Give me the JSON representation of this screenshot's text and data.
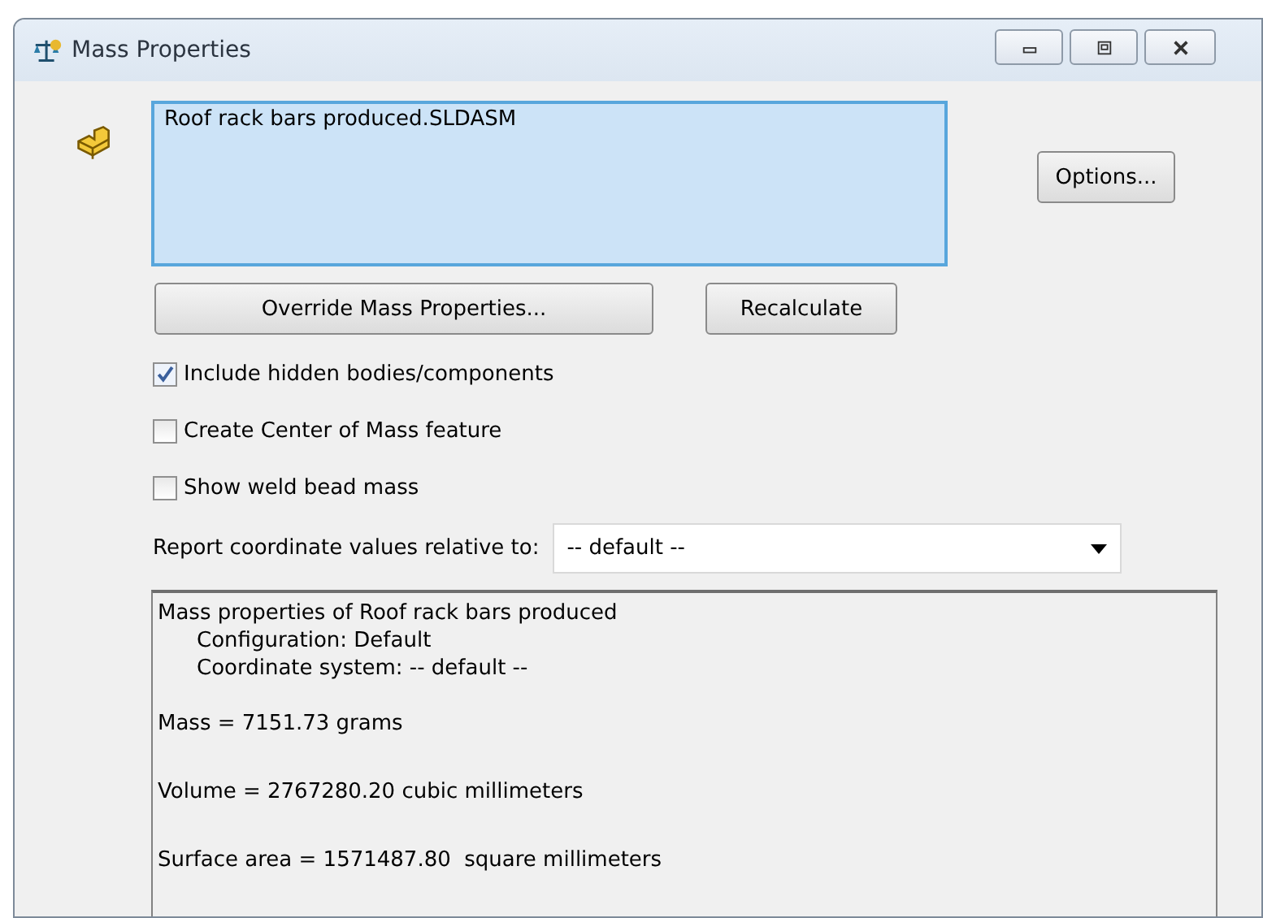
{
  "window": {
    "title": "Mass Properties",
    "controls": [
      {
        "kind": "minimize"
      },
      {
        "kind": "maximize"
      },
      {
        "kind": "close"
      }
    ]
  },
  "selection": {
    "items": [
      "Roof rack bars produced.SLDASM"
    ]
  },
  "buttons": {
    "options": "Options...",
    "override": "Override Mass Properties...",
    "recalculate": "Recalculate"
  },
  "checkboxes": [
    {
      "label": "Include hidden bodies/components",
      "checked": true
    },
    {
      "label": "Create Center of Mass feature",
      "checked": false
    },
    {
      "label": "Show weld bead mass",
      "checked": false
    }
  ],
  "report": {
    "label": "Report coordinate values relative to:",
    "value": "-- default --"
  },
  "results": [
    {
      "lines": [
        {
          "text": "Mass properties of Roof rack bars produced",
          "indented": false
        },
        {
          "text": "Configuration: Default",
          "indented": true
        },
        {
          "text": "Coordinate system: -- default --",
          "indented": true
        }
      ]
    },
    {
      "lines": [
        {
          "text": "Mass = 7151.73 grams",
          "indented": false
        }
      ]
    },
    {
      "lines": [
        {
          "text": "Volume = 2767280.20 cubic millimeters",
          "indented": false
        }
      ]
    },
    {
      "lines": [
        {
          "text": "Surface area = 1571487.80  square millimeters",
          "indented": false
        }
      ]
    }
  ]
}
